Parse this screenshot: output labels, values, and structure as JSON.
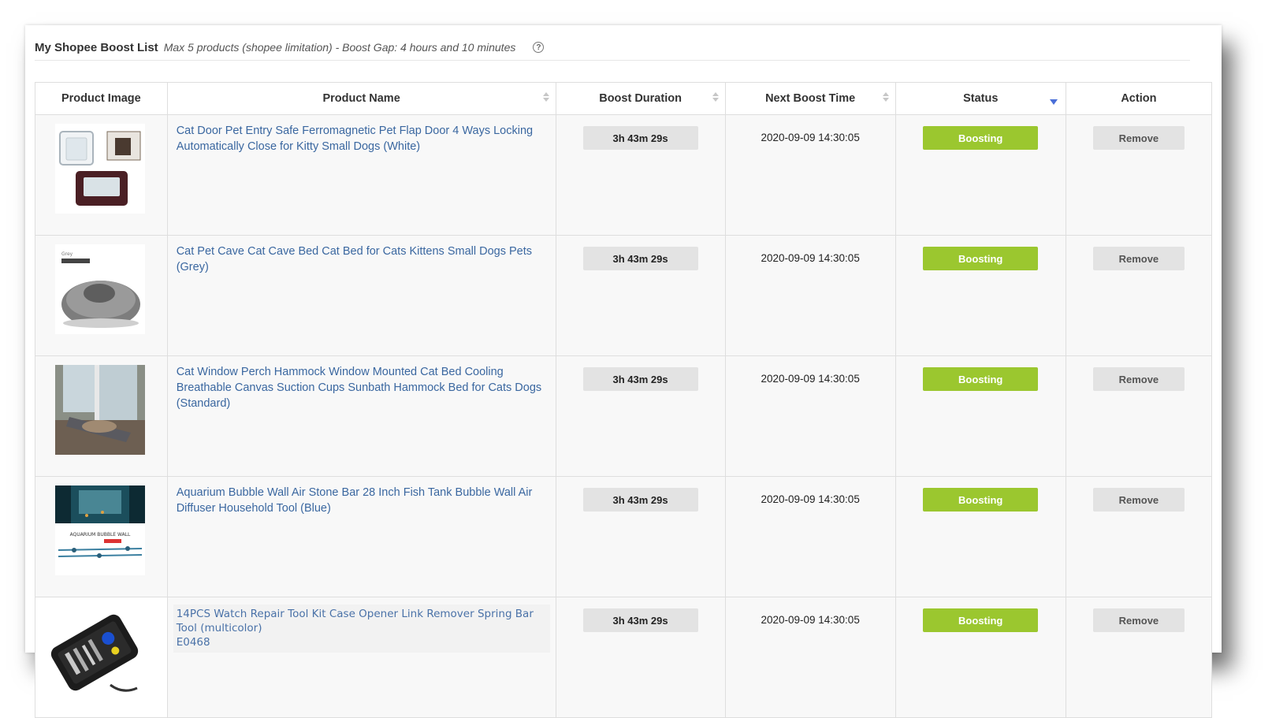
{
  "header": {
    "title": "My Shopee Boost List",
    "subtitle": "Max 5 products (shopee limitation) - Boost Gap: 4 hours and 10 minutes",
    "help_glyph": "?"
  },
  "columns": {
    "image": "Product Image",
    "name": "Product Name",
    "duration": "Boost Duration",
    "next": "Next Boost Time",
    "status": "Status",
    "action": "Action"
  },
  "rows": [
    {
      "image": "cat-door-image",
      "name": "Cat Door Pet Entry Safe Ferromagnetic Pet Flap Door 4 Ways Locking Automatically Close for Kitty Small Dogs (White)",
      "duration": "3h 43m 29s",
      "next": "2020-09-09 14:30:05",
      "status": "Boosting",
      "action": "Remove"
    },
    {
      "image": "cat-cave-bed-image",
      "image_label": "Grey",
      "name": "Cat Pet Cave Cat Cave Bed Cat Bed for Cats Kittens Small Dogs Pets (Grey)",
      "duration": "3h 43m 29s",
      "next": "2020-09-09 14:30:05",
      "status": "Boosting",
      "action": "Remove"
    },
    {
      "image": "window-perch-hammock-image",
      "name": "Cat Window Perch Hammock Window Mounted Cat Bed Cooling Breathable Canvas Suction Cups Sunbath Hammock Bed for Cats Dogs (Standard)",
      "duration": "3h 43m 29s",
      "next": "2020-09-09 14:30:05",
      "status": "Boosting",
      "action": "Remove"
    },
    {
      "image": "aquarium-bubble-wall-image",
      "image_label": "AQUARIUM BUBBLE WALL",
      "name": "Aquarium Bubble Wall Air Stone Bar 28 Inch Fish Tank Bubble Wall Air Diffuser Household Tool (Blue)",
      "duration": "3h 43m 29s",
      "next": "2020-09-09 14:30:05",
      "status": "Boosting",
      "action": "Remove"
    },
    {
      "image": "watch-repair-kit-image",
      "name": "14PCS Watch Repair Tool Kit Case Opener Link Remover Spring Bar Tool (multicolor)",
      "sku": "E0468",
      "duration": "3h 43m 29s",
      "next": "2020-09-09 14:30:05",
      "status": "Boosting",
      "action": "Remove"
    }
  ],
  "colors": {
    "link": "#3a67a0",
    "boosting": "#9bc72f",
    "chip_grey": "#e3e3e3",
    "sort_active": "#4a6fd8"
  }
}
